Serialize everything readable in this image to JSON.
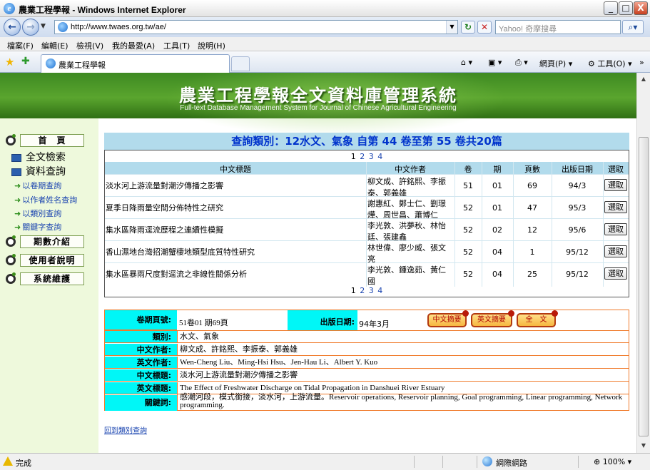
{
  "window": {
    "title": "農業工程學報 - Windows Internet Explorer",
    "address": "http://www.twaes.org.tw/ae/",
    "search_placeholder": "Yahoo! 奇摩搜尋",
    "min_label": "_",
    "max_label": "□",
    "close_label": "X"
  },
  "menu": [
    "檔案(F)",
    "編輯(E)",
    "檢視(V)",
    "我的最愛(A)",
    "工具(T)",
    "說明(H)"
  ],
  "tab": {
    "label": "農業工程學報"
  },
  "commands": {
    "page": "網頁(P)",
    "tools": "工具(O)",
    "more": "»"
  },
  "banner": {
    "title": "農業工程學報全文資料庫管理系統",
    "subtitle": "Full-text Database Management System for Journal of Chinese Agricultural Engineering"
  },
  "sidebar": {
    "home": "首　頁",
    "fulltext": "全文檢索",
    "data_query": "資料查詢",
    "links": [
      "以卷期查詢",
      "以作者姓名查詢",
      "以類別查詢",
      "關鍵字查詢"
    ],
    "issues": "期數介紹",
    "user_guide": "使用者說明",
    "maintenance": "系統維護"
  },
  "query": {
    "title": "查詢類別：12水文、氣象 自第 44 卷至第 55 卷共20篇",
    "pages_current": "1",
    "pages_others": [
      "2",
      "3",
      "4"
    ],
    "columns": [
      "中文標題",
      "中文作者",
      "卷",
      "期",
      "頁數",
      "出版日期",
      "選取"
    ],
    "select_label": "選取",
    "rows": [
      {
        "title": "淡水河上游流量對潮汐傳播之影響",
        "author": "柳文成、許銘熙、李振泰、郭義雄",
        "vol": "51",
        "issue": "01",
        "pages": "69",
        "date": "94/3"
      },
      {
        "title": "夏季日降雨量空間分佈特性之研究",
        "author": "謝惠紅、鄭士仁、劉璟燁、周世昌、蕭博仁",
        "vol": "52",
        "issue": "01",
        "pages": "47",
        "date": "95/3"
      },
      {
        "title": "集水區降雨逕流歷程之連續性模擬",
        "author": "李光敦、洪夢秋、林怡廷、張建鑫",
        "vol": "52",
        "issue": "02",
        "pages": "12",
        "date": "95/6"
      },
      {
        "title": "香山濕地台灣招潮蟹棲地類型底質特性研究",
        "author": "林世偉、廖少威、張文亮",
        "vol": "52",
        "issue": "04",
        "pages": "1",
        "date": "95/12"
      },
      {
        "title": "集水區暴雨尺度對逕流之非線性關係分析",
        "author": "李光敦、鍾逸茹、黃仁國",
        "vol": "52",
        "issue": "04",
        "pages": "25",
        "date": "95/12"
      }
    ]
  },
  "detail": {
    "vol_page_label": "卷期頁號:",
    "vol_page_value": "51卷01 期69頁",
    "date_label": "出版日期:",
    "date_value": "94年3月",
    "buttons": [
      "中文摘要",
      "英文摘要",
      "全　文"
    ],
    "category_label": "類別:",
    "category_value": "水文、氣象",
    "cn_author_label": "中文作者:",
    "cn_author_value": "柳文成、許銘熙、李振泰、郭義雄",
    "en_author_label": "英文作者:",
    "en_author_value": "Wen-Cheng Liu、Ming-Hsi Hsu、Jen-Hau Li、Albert Y. Kuo",
    "cn_title_label": "中文標題:",
    "cn_title_value": "淡水河上游流量對潮汐傳播之影響",
    "en_title_label": "英文標題:",
    "en_title_value": "The Effect of Freshwater Discharge on Tidal Propagation in Danshuei River Estuary",
    "keyword_label": "關鍵詞:",
    "keyword_value": "感潮河段，模式銜接，淡水河，上游流量。Reservoir operations, Reservoir planning, Goal programming, Linear programming, Network programming."
  },
  "back_link": "回到類別查詢",
  "status": {
    "text": "完成",
    "zone": "網際網路",
    "zoom": "100%"
  }
}
